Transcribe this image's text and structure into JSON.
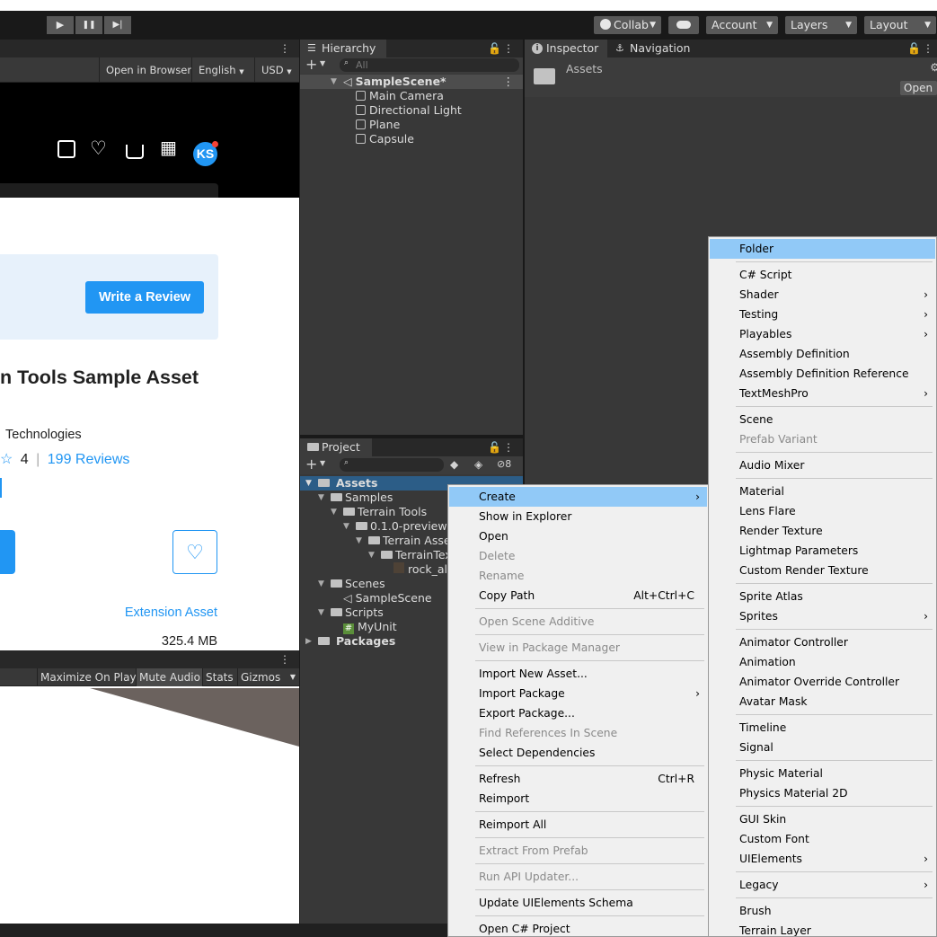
{
  "toolbar": {
    "play_icon": "▶",
    "pause_icon": "❚❚",
    "step_icon": "▶|",
    "collab": "Collab",
    "account": "Account",
    "layers": "Layers",
    "layout": "Layout"
  },
  "store": {
    "open_in_browser": "Open in Browser",
    "language": "English",
    "currency": "USD",
    "avatar_initials": "KS",
    "write_review": "Write a Review",
    "title_fragment": "n Tools Sample Asset",
    "publisher_fragment": "Technologies",
    "rating": "4",
    "reviews": "199 Reviews",
    "category": "Extension Asset",
    "size": "325.4 MB"
  },
  "game": {
    "maximize": "Maximize On Play",
    "mute": "Mute Audio",
    "stats": "Stats",
    "gizmos": "Gizmos"
  },
  "hierarchy": {
    "tab": "Hierarchy",
    "search_placeholder": "All",
    "scene": "SampleScene*",
    "items": [
      "Main Camera",
      "Directional Light",
      "Plane",
      "Capsule"
    ]
  },
  "project": {
    "tab": "Project",
    "hidden_count": "8",
    "assets": "Assets",
    "tree": [
      {
        "label": "Samples",
        "indent": 1
      },
      {
        "label": "Terrain Tools",
        "indent": 2
      },
      {
        "label": "0.1.0-preview",
        "indent": 3
      },
      {
        "label": "Terrain Asset",
        "indent": 4
      },
      {
        "label": "TerrainTex",
        "indent": 5
      },
      {
        "label": "rock_alb",
        "indent": 6
      },
      {
        "label": "Scenes",
        "indent": 1
      },
      {
        "label": "SampleScene",
        "indent": 2
      },
      {
        "label": "Scripts",
        "indent": 1
      },
      {
        "label": "MyUnit",
        "indent": 2
      }
    ],
    "packages": "Packages"
  },
  "inspector": {
    "tab": "Inspector",
    "nav_tab": "Navigation",
    "path": "Assets",
    "open": "Open"
  },
  "context_menu": [
    {
      "label": "Create",
      "hl": true,
      "sub": true
    },
    {
      "label": "Show in Explorer"
    },
    {
      "label": "Open"
    },
    {
      "label": "Delete",
      "dis": true
    },
    {
      "label": "Rename",
      "dis": true
    },
    {
      "label": "Copy Path",
      "shortcut": "Alt+Ctrl+C"
    },
    {
      "sep": true
    },
    {
      "label": "Open Scene Additive",
      "dis": true
    },
    {
      "sep": true
    },
    {
      "label": "View in Package Manager",
      "dis": true
    },
    {
      "sep": true
    },
    {
      "label": "Import New Asset..."
    },
    {
      "label": "Import Package",
      "sub": true
    },
    {
      "label": "Export Package..."
    },
    {
      "label": "Find References In Scene",
      "dis": true
    },
    {
      "label": "Select Dependencies"
    },
    {
      "sep": true
    },
    {
      "label": "Refresh",
      "shortcut": "Ctrl+R"
    },
    {
      "label": "Reimport"
    },
    {
      "sep": true
    },
    {
      "label": "Reimport All"
    },
    {
      "sep": true
    },
    {
      "label": "Extract From Prefab",
      "dis": true
    },
    {
      "sep": true
    },
    {
      "label": "Run API Updater...",
      "dis": true
    },
    {
      "sep": true
    },
    {
      "label": "Update UIElements Schema"
    },
    {
      "sep": true
    },
    {
      "label": "Open C# Project"
    }
  ],
  "create_menu": [
    {
      "label": "Folder",
      "hl": true
    },
    {
      "sep": true
    },
    {
      "label": "C# Script"
    },
    {
      "label": "Shader",
      "sub": true
    },
    {
      "label": "Testing",
      "sub": true
    },
    {
      "label": "Playables",
      "sub": true
    },
    {
      "label": "Assembly Definition"
    },
    {
      "label": "Assembly Definition Reference"
    },
    {
      "label": "TextMeshPro",
      "sub": true
    },
    {
      "sep": true
    },
    {
      "label": "Scene"
    },
    {
      "label": "Prefab Variant",
      "dis": true
    },
    {
      "sep": true
    },
    {
      "label": "Audio Mixer"
    },
    {
      "sep": true
    },
    {
      "label": "Material"
    },
    {
      "label": "Lens Flare"
    },
    {
      "label": "Render Texture"
    },
    {
      "label": "Lightmap Parameters"
    },
    {
      "label": "Custom Render Texture"
    },
    {
      "sep": true
    },
    {
      "label": "Sprite Atlas"
    },
    {
      "label": "Sprites",
      "sub": true
    },
    {
      "sep": true
    },
    {
      "label": "Animator Controller"
    },
    {
      "label": "Animation"
    },
    {
      "label": "Animator Override Controller"
    },
    {
      "label": "Avatar Mask"
    },
    {
      "sep": true
    },
    {
      "label": "Timeline"
    },
    {
      "label": "Signal"
    },
    {
      "sep": true
    },
    {
      "label": "Physic Material"
    },
    {
      "label": "Physics Material 2D"
    },
    {
      "sep": true
    },
    {
      "label": "GUI Skin"
    },
    {
      "label": "Custom Font"
    },
    {
      "label": "UIElements",
      "sub": true
    },
    {
      "sep": true
    },
    {
      "label": "Legacy",
      "sub": true
    },
    {
      "sep": true
    },
    {
      "label": "Brush"
    },
    {
      "label": "Terrain Layer"
    }
  ]
}
